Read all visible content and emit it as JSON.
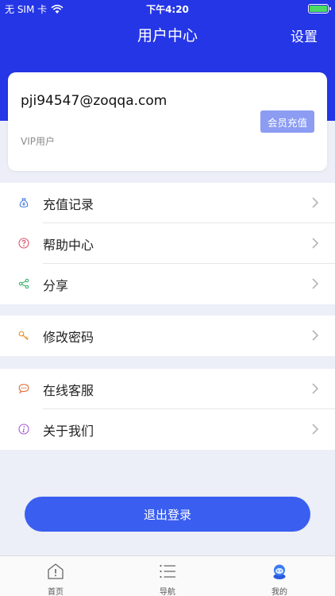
{
  "status_bar": {
    "carrier": "无 SIM 卡",
    "time": "下午4:20"
  },
  "header": {
    "title": "用户中心",
    "settings_label": "设置"
  },
  "user_card": {
    "email": "pji94547@zoqqa.com",
    "level": "VIP用户",
    "recharge_label": "会员充值"
  },
  "menu_groups": [
    {
      "items": [
        {
          "label": "充值记录",
          "icon": "moneybag-icon"
        },
        {
          "label": "帮助中心",
          "icon": "help-icon"
        },
        {
          "label": "分享",
          "icon": "share-icon"
        }
      ]
    },
    {
      "items": [
        {
          "label": "修改密码",
          "icon": "key-icon"
        }
      ]
    },
    {
      "items": [
        {
          "label": "在线客服",
          "icon": "chat-icon"
        },
        {
          "label": "关于我们",
          "icon": "info-icon"
        }
      ]
    }
  ],
  "logout_label": "退出登录",
  "tab_bar": [
    {
      "label": "首页",
      "icon": "home-icon"
    },
    {
      "label": "导航",
      "icon": "list-icon"
    },
    {
      "label": "我的",
      "icon": "profile-icon"
    }
  ],
  "colors": {
    "primary": "#2536e6",
    "button": "#3a5ef0",
    "recharge": "#8b9cf2",
    "background": "#eceef8"
  }
}
